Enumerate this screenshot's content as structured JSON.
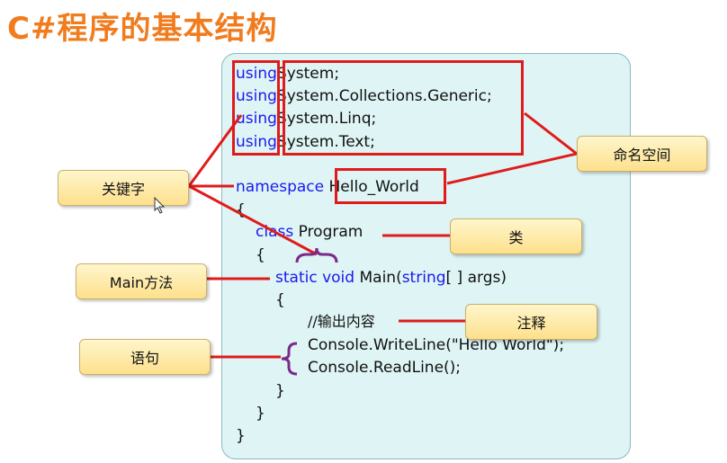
{
  "title": "C#程序的基本结构",
  "code": {
    "using_kw": "using",
    "using_targets": [
      "System;",
      "System.Collections.Generic;",
      "System.Linq;",
      "System.Text;"
    ],
    "namespace_kw": "namespace",
    "namespace_name": "Hello_World",
    "open_brace": "{",
    "close_brace": "}",
    "class_kw": "class",
    "class_name": "Program",
    "static_kw": "static",
    "void_kw": "void",
    "main_name": "Main(",
    "string_kw": "string",
    "main_args": "[ ] args)",
    "comment": "//输出内容",
    "stmt1": "Console.WriteLine(\"Hello World\");",
    "stmt2": "Console.ReadLine();"
  },
  "callouts": {
    "keyword": "关键字",
    "namespace": "命名空间",
    "class": "类",
    "main": "Main方法",
    "comment": "注释",
    "statement": "语句"
  },
  "colors": {
    "title": "#f07c1e",
    "keyword": "#1a1aee",
    "annotation": "#e01b1b",
    "brace_mark": "#7b2a8a",
    "panel": "#dff4f4",
    "callout": "#fde08c"
  }
}
